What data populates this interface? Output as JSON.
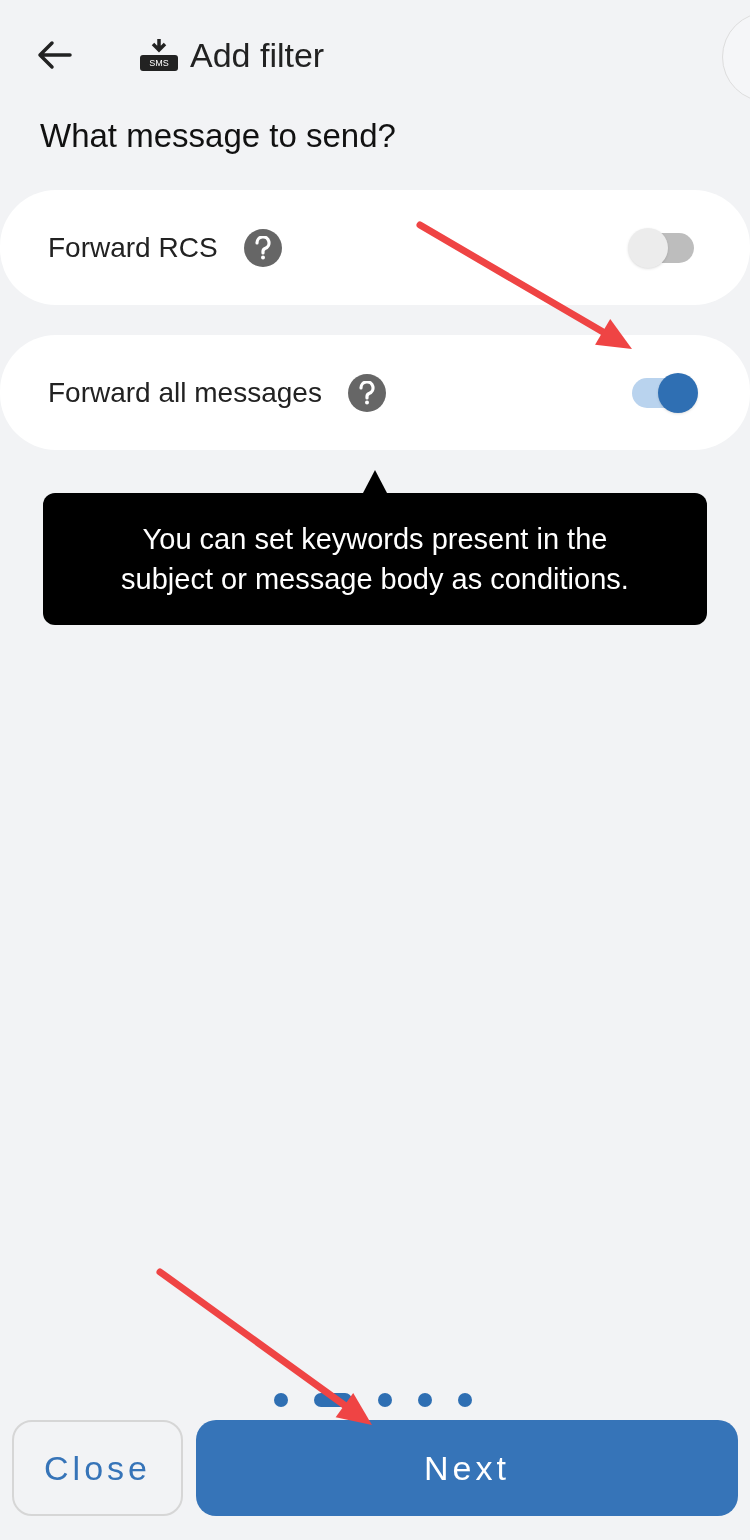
{
  "header": {
    "title": "Add filter",
    "icon_text": "SMS"
  },
  "question": "What message to send?",
  "options": [
    {
      "label": "Forward RCS",
      "on": false
    },
    {
      "label": "Forward all messages",
      "on": true
    }
  ],
  "tooltip": "You can set keywords present in the subject or message body as conditions.",
  "pager": [
    {
      "selected": false
    },
    {
      "selected": true
    },
    {
      "selected": false
    },
    {
      "selected": false
    },
    {
      "selected": false
    }
  ],
  "buttons": [
    {
      "label": "Close",
      "kind": "secondary"
    },
    {
      "label": "Next",
      "kind": "primary"
    }
  ]
}
